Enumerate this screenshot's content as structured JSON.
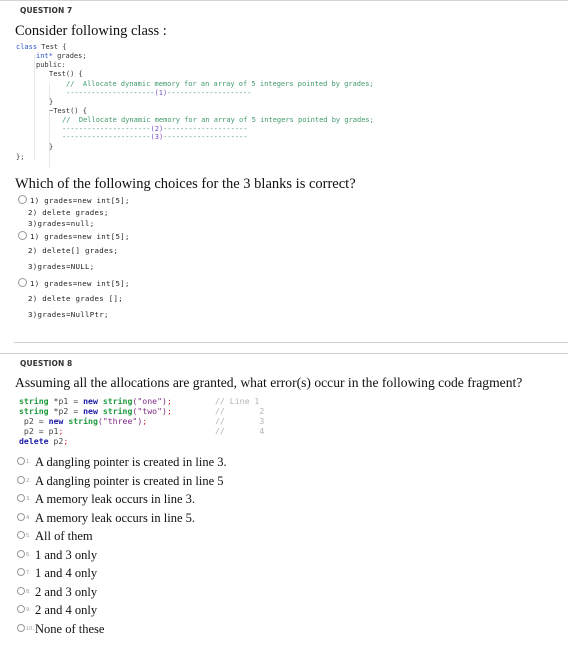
{
  "q7": {
    "label": "QUESTION 7",
    "prompt": "Consider following class :",
    "code": {
      "l1_kw": "class",
      "l1_rest": " Test {",
      "l2_kw": "int*",
      "l2_rest": " grades;",
      "l3": "public:",
      "l4": "Test() {",
      "l5": "//  Allocate dynamic memory for an array of 5 integers pointed by grades;",
      "l6_a": "---------------------",
      "l6_b": "(1)",
      "l6_c": "--------------------",
      "l7": "}",
      "l8": "~Test() {",
      "l9": "//  Dellocate dynamic memory for an array of 5 integers pointed by grades;",
      "l10_a": "---------------------",
      "l10_b": "(2)",
      "l10_c": "--------------------",
      "l11_a": "---------------------",
      "l11_b": "(3)",
      "l11_c": "--------------------",
      "l12": "}",
      "l13": "};"
    },
    "question": "Which of the following choices for the 3 blanks is correct?",
    "options": [
      {
        "lines": [
          "1) grades=new int[5];",
          "2) delete grades;",
          "3)grades=null;"
        ]
      },
      {
        "lines": [
          "1) grades=new int[5];",
          "2) delete[] grades;",
          "3)grades=NULL;"
        ]
      },
      {
        "lines": [
          "1) grades=new int[5];",
          "2) delete grades [];",
          "3)grades=NullPtr;"
        ]
      }
    ]
  },
  "q8": {
    "label": "QUESTION 8",
    "prompt": "Assuming all the allocations are granted, what error(s) occur in the following code fragment?",
    "code": {
      "l1": {
        "type": "string",
        "ptr": "*p1",
        "eq": " = ",
        "new": "new",
        "ctor": "string",
        "arg": "(\"one\")",
        "semi": ";",
        "comment": "// Line 1"
      },
      "l2": {
        "type": "string",
        "ptr": "*p2",
        "eq": " = ",
        "new": "new",
        "ctor": "string",
        "arg": "(\"two\")",
        "semi": ";",
        "comment": "//       2"
      },
      "l3": {
        "lhs": " p2 = ",
        "new": "new",
        "ctor": "string",
        "arg": "(\"three\")",
        "semi": ";",
        "comment": "//       3"
      },
      "l4": {
        "lhs": " p2 = p1",
        "semi": ";",
        "comment": "//       4"
      },
      "l5": {
        "kw": "delete",
        "rest": " p2",
        "semi": ";"
      }
    },
    "options": [
      {
        "num": "1.",
        "text": "A dangling pointer is created in line 3."
      },
      {
        "num": "2.",
        "text": "A dangling pointer is created in line 5"
      },
      {
        "num": "3.",
        "text": "A memory leak occurs in line 3."
      },
      {
        "num": "4.",
        "text": "A memory leak occurs in line 5."
      },
      {
        "num": "5.",
        "text": "All of them"
      },
      {
        "num": "6.",
        "text": "1 and 3 only"
      },
      {
        "num": "7.",
        "text": "1 and 4 only"
      },
      {
        "num": "8.",
        "text": "2 and 3 only"
      },
      {
        "num": "9.",
        "text": "2 and 4 only"
      },
      {
        "num": "10.",
        "text": "None of these"
      }
    ]
  }
}
